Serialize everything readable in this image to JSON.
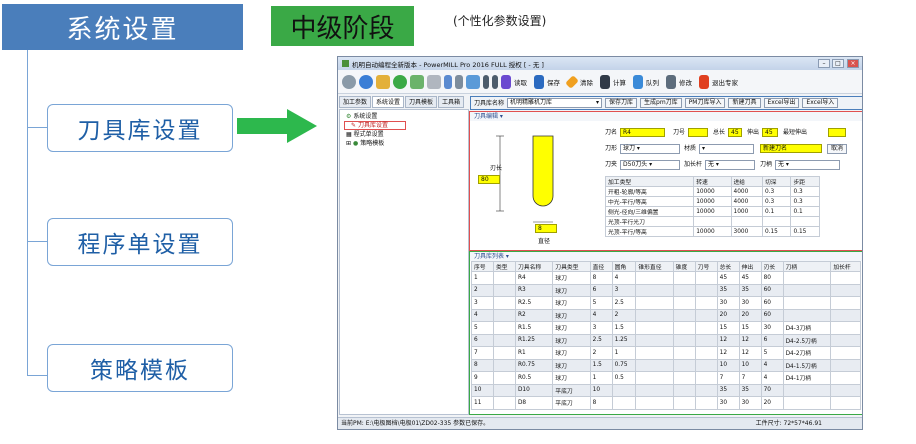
{
  "header": {
    "title": "系统设置",
    "stage": "中级阶段",
    "subtitle": "(个性化参数设置)"
  },
  "left_items": [
    "刀具库设置",
    "程序单设置",
    "策略模板"
  ],
  "window": {
    "title": "机明自动编程全新版本 - PowerMILL Pro 2016 FULL 授权 [ - 无 ]",
    "toolbar": [
      "读取",
      "保存",
      "清除",
      "计算",
      "队列",
      "修改",
      "退出专家"
    ],
    "tabs": [
      "加工参数",
      "系统设置",
      "刀具模板",
      "工具箱"
    ],
    "tree": [
      "系统设置",
      "刀具库设置",
      "程式单设置",
      "策略模板"
    ],
    "rightbar": {
      "tool_label": "刀具库名称",
      "tool_value": "机明精雕机刀库",
      "buttons": [
        "保存刀库",
        "生成pm刀库",
        "PM刀库导入",
        "新建刀具",
        "Excel导出",
        "Excel导入"
      ]
    },
    "panel1": {
      "title": "刀具编辑",
      "drawing": {
        "length_label": "刃长",
        "length_value": "80",
        "dia_value": "8",
        "dia_label": "直径"
      },
      "fields": {
        "name_label": "刀名",
        "name_value": "R4",
        "num_label": "刀号",
        "len_label": "总长",
        "len_value": "45",
        "out_label": "伸出",
        "out_value": "45",
        "minout_label": "最短伸出",
        "type_label": "刀形",
        "type_value": "球刀",
        "mat_label": "材质",
        "new_btn": "新建刀名",
        "cancel_btn": "取消",
        "chuck_label": "刀夹",
        "chuck_value": "D50刀头",
        "ext_label": "加长杆",
        "ext_value": "无",
        "holder_label": "刀柄",
        "holder_value": "无"
      },
      "param_headers": [
        "加工类型",
        "转速",
        "进给",
        "切深",
        "步距"
      ],
      "param_rows": [
        [
          "开粗-轮廓/等高",
          "10000",
          "4000",
          "0.3",
          "0.3"
        ],
        [
          "中光-平行/等高",
          "10000",
          "4000",
          "0.3",
          "0.3"
        ],
        [
          "侧光-径向/三维偏置",
          "10000",
          "1000",
          "0.1",
          "0.1"
        ],
        [
          "光顶-平行光刀",
          "",
          "",
          "",
          ""
        ],
        [
          "光顶-平行/等高",
          "10000",
          "3000",
          "0.15",
          "0.15"
        ]
      ]
    },
    "panel2": {
      "title": "刀具库列表",
      "headers": [
        "序号",
        "类型",
        "刀具名称",
        "刀具类型",
        "直径",
        "圆角",
        "锥形直径",
        "锥度",
        "刀号",
        "总长",
        "伸出",
        "刃长",
        "刀柄",
        "加长杆"
      ],
      "rows": [
        [
          "1",
          "",
          "R4",
          "球刀",
          "8",
          "4",
          "",
          "",
          "",
          "45",
          "45",
          "80",
          "",
          ""
        ],
        [
          "2",
          "",
          "R3",
          "球刀",
          "6",
          "3",
          "",
          "",
          "",
          "35",
          "35",
          "60",
          "",
          ""
        ],
        [
          "3",
          "",
          "R2.5",
          "球刀",
          "5",
          "2.5",
          "",
          "",
          "",
          "30",
          "30",
          "60",
          "",
          ""
        ],
        [
          "4",
          "",
          "R2",
          "球刀",
          "4",
          "2",
          "",
          "",
          "",
          "20",
          "20",
          "60",
          "",
          ""
        ],
        [
          "5",
          "",
          "R1.5",
          "球刀",
          "3",
          "1.5",
          "",
          "",
          "",
          "15",
          "15",
          "30",
          "D4-3刀柄",
          ""
        ],
        [
          "6",
          "",
          "R1.25",
          "球刀",
          "2.5",
          "1.25",
          "",
          "",
          "",
          "12",
          "12",
          "6",
          "D4-2.5刀柄",
          ""
        ],
        [
          "7",
          "",
          "R1",
          "球刀",
          "2",
          "1",
          "",
          "",
          "",
          "12",
          "12",
          "5",
          "D4-2刀柄",
          ""
        ],
        [
          "8",
          "",
          "R0.75",
          "球刀",
          "1.5",
          "0.75",
          "",
          "",
          "",
          "10",
          "10",
          "4",
          "D4-1.5刀柄",
          ""
        ],
        [
          "9",
          "",
          "R0.5",
          "球刀",
          "1",
          "0.5",
          "",
          "",
          "",
          "7",
          "7",
          "4",
          "D4-1刀柄",
          ""
        ],
        [
          "10",
          "",
          "D10",
          "平底刀",
          "10",
          "",
          "",
          "",
          "",
          "35",
          "35",
          "70",
          "",
          ""
        ],
        [
          "11",
          "",
          "D8",
          "平底刀",
          "8",
          "",
          "",
          "",
          "",
          "30",
          "30",
          "20",
          "",
          ""
        ]
      ]
    },
    "status": {
      "left": "当前PM: E:\\电极图档\\电极01\\ZD02-335 参数已保存。",
      "right": "工件尺寸: 72*57*46.91"
    }
  },
  "colors": {
    "blue": "#4a7ebb",
    "green": "#3aa946",
    "red": "#e05050",
    "yellow": "#ffff00"
  }
}
